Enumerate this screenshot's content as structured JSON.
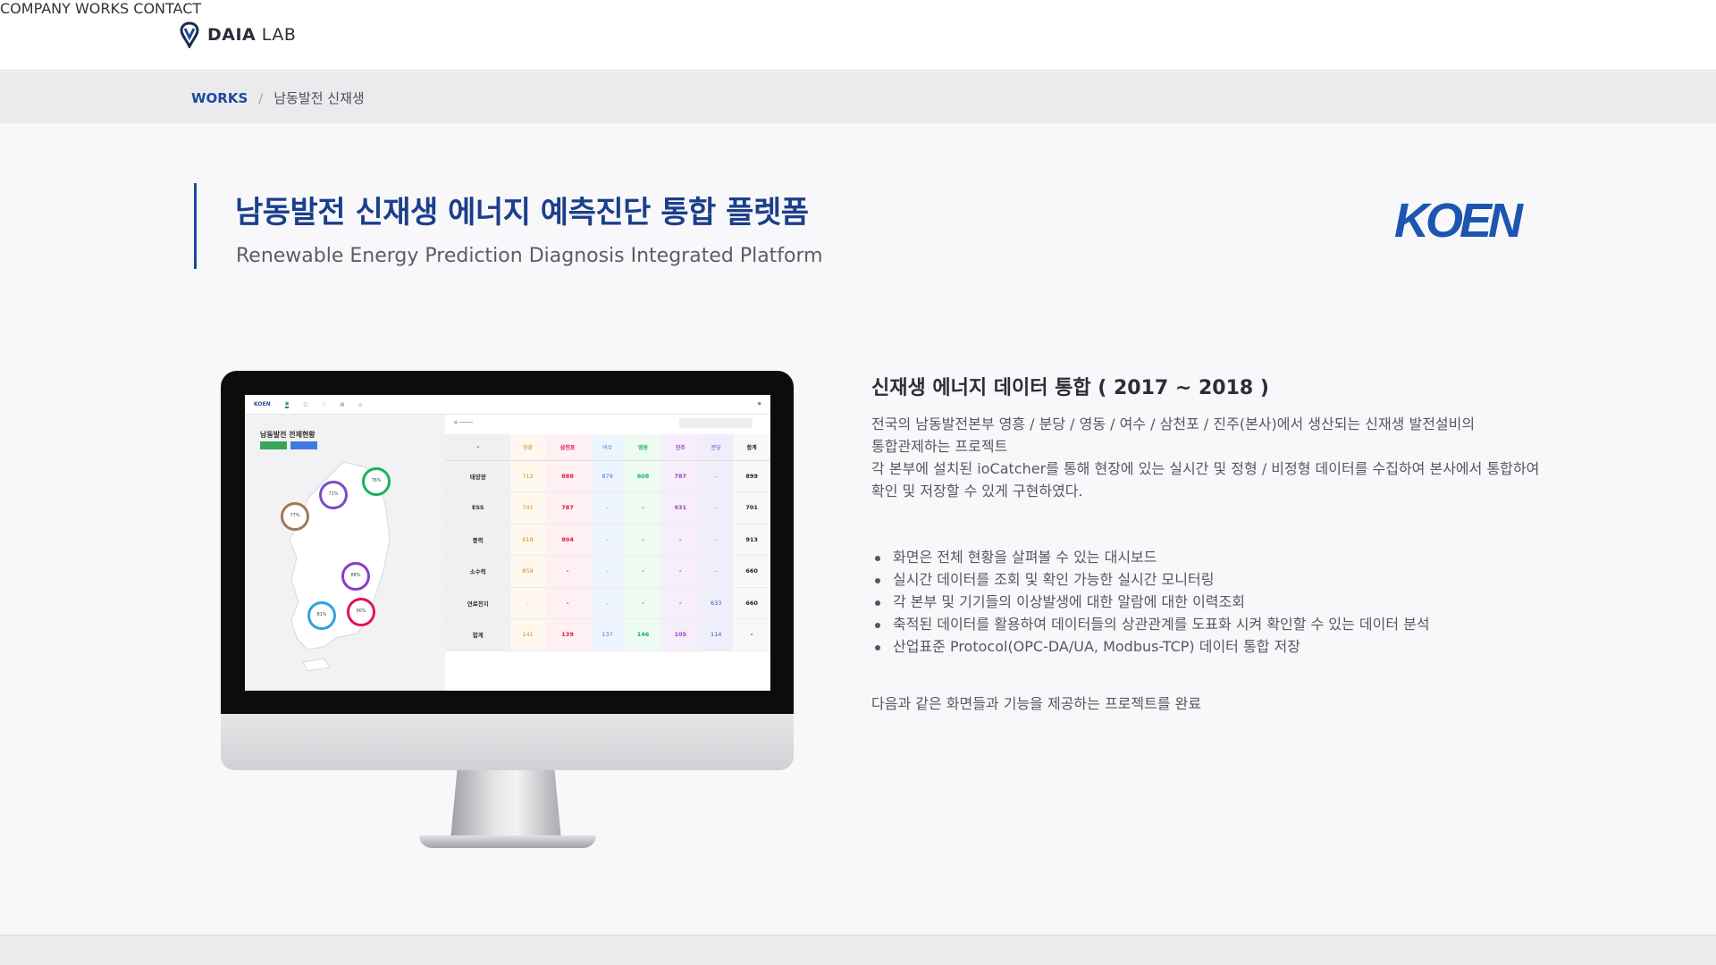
{
  "header": {
    "logo_bold": "DAIA",
    "logo_light": "LAB",
    "nav": [
      "COMPANY",
      "WORKS",
      "CONTACT"
    ]
  },
  "breadcrumb": {
    "root": "WORKS",
    "separator": "/",
    "current": "남동발전 신재생"
  },
  "project": {
    "title": "남동발전 신재생 에너지 예측진단 통합 플렛폼",
    "subtitle": "Renewable Energy Prediction Diagnosis Integrated Platform",
    "client_logo": "KOEN"
  },
  "screen": {
    "dashboard_title": "남동발전 전체현황",
    "table_header": [
      "-",
      "영흥",
      "삼천포",
      "여수",
      "영동",
      "진주",
      "분당",
      "합계"
    ],
    "table_rows": [
      [
        "태양광",
        "712",
        "888",
        "879",
        "608",
        "787",
        "-",
        "899"
      ],
      [
        "ESS",
        "741",
        "787",
        "-",
        "-",
        "931",
        "-",
        "701"
      ],
      [
        "풍력",
        "618",
        "804",
        "-",
        "-",
        "-",
        "-",
        "913"
      ],
      [
        "소수력",
        "859",
        "-",
        "-",
        "-",
        "-",
        "-",
        "660"
      ],
      [
        "연료전지",
        "-",
        "-",
        "-",
        "-",
        "-",
        "633",
        "660"
      ],
      [
        "합계",
        "141",
        "139",
        "137",
        "146",
        "105",
        "114",
        "-"
      ]
    ],
    "rings": [
      "76%",
      "71%",
      "77%",
      "88%",
      "81%",
      "90%"
    ]
  },
  "description": {
    "title": "신재생 에너지 데이터 통합 ( 2017 ~ 2018 )",
    "paragraphs": [
      "전국의 남동발전본부 영흥 / 분당 / 영동 / 여수 / 삼천포 / 진주(본사)에서 생산되는 신재생 발전설비의",
      "통합관제하는 프로젝트",
      "각 본부에 설치된 ioCatcher를 통해 현장에 있는 실시간 및 정형 / 비정형 데이터를 수집하여 본사에서 통합하여",
      "확인 및 저장할 수 있게 구현하였다."
    ],
    "features": [
      "화면은 전체 현황을 살펴볼 수 있는 대시보드",
      "실시간 데이터를 조회 및 확인 가능한 실시간 모니터링",
      "각 본부 및 기기들의 이상발생에 대한 알람에 대한 이력조회",
      "축적된 데이터를 활용하여 데이터들의 상관관계를 도표화 시켜 확인할 수 있는 데이터 분석",
      "산업표준 Protocol(OPC-DA/UA, Modbus-TCP) 데이터 통합 저장"
    ],
    "outro": "다음과 같은 화면들과 기능을 제공하는 프로젝트를 완료"
  },
  "colors": {
    "brand": "#1d4a9e",
    "text": "#555861"
  }
}
